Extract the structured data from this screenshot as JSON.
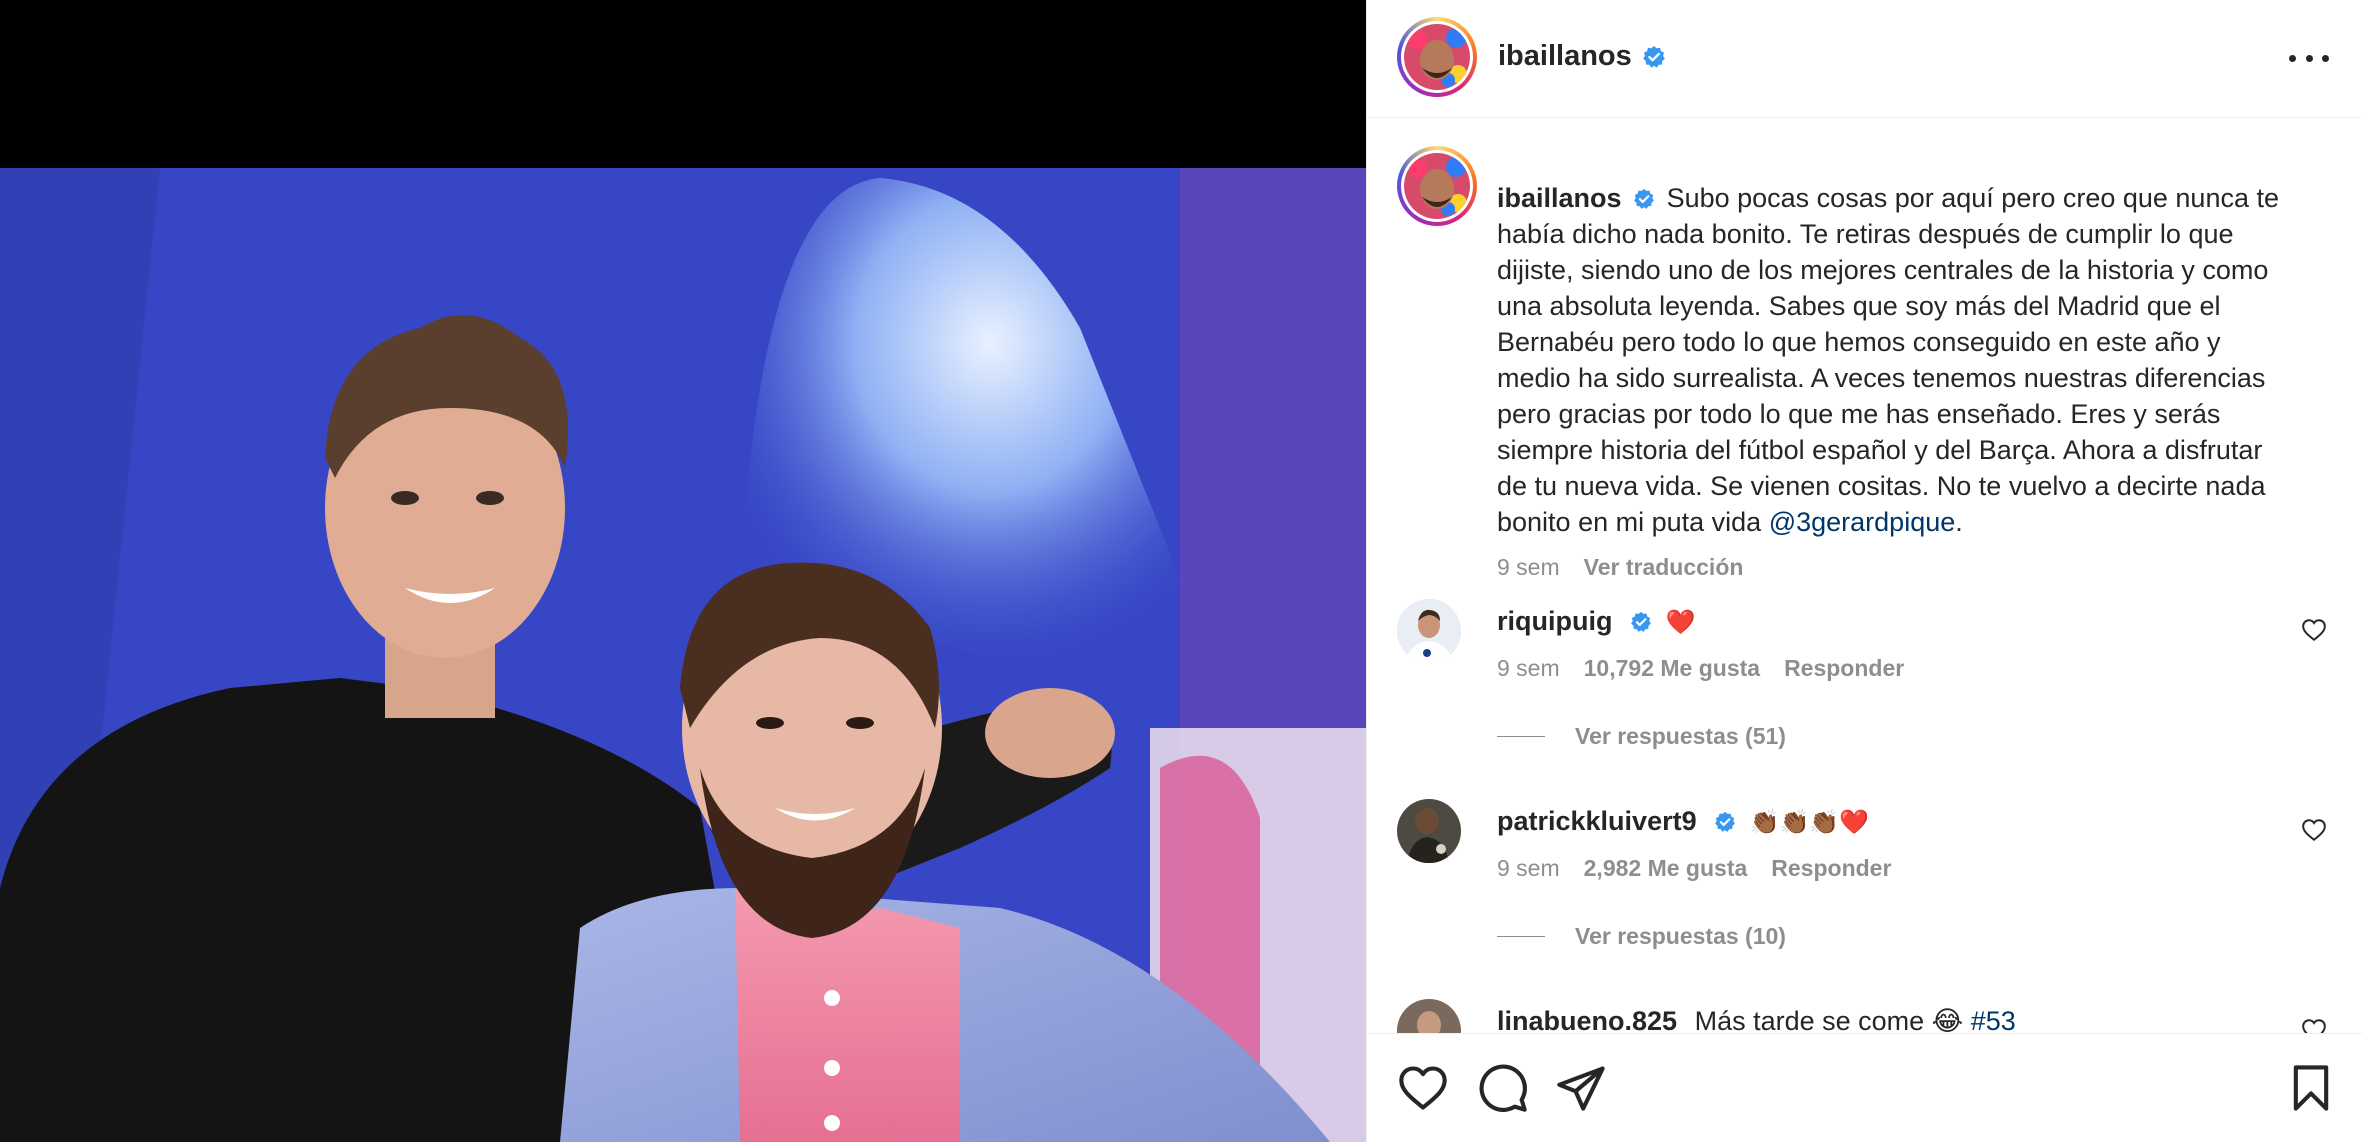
{
  "post": {
    "username": "ibaillanos",
    "more_icon": "more-horizontal-icon",
    "caption_text": "Subo pocas cosas por aquí pero creo que nunca te había dicho nada bonito. Te retiras después de cumplir lo que dijiste, siendo uno de los mejores centrales de la historia y como una absoluta leyenda. Sabes que soy más del Madrid que el Bernabéu pero todo lo que hemos conseguido en este año y medio ha sido surrealista. A veces tenemos nuestras diferencias pero gracias por todo lo que me has enseñado. Eres y serás siempre historia del fútbol español y del Barça. Ahora a disfrutar de tu nueva vida. Se vienen cositas. No te vuelvo a decirte nada bonito en mi puta vida",
    "caption_mention": "@3gerardpique",
    "caption_end": ".",
    "caption_time": "9 sem",
    "translate_label": "Ver traducción"
  },
  "comments": [
    {
      "username": "riquipuig",
      "text": "❤️",
      "time": "9 sem",
      "likes": "10,792 Me gusta",
      "reply_label": "Responder",
      "replies_label": "Ver respuestas (51)"
    },
    {
      "username": "patrickkluivert9",
      "text": "👏🏾👏🏾👏🏾❤️",
      "time": "9 sem",
      "likes": "2,982 Me gusta",
      "reply_label": "Responder",
      "replies_label": "Ver respuestas (10)"
    },
    {
      "username": "linabueno.825",
      "text": "Más tarde se come 😂",
      "hashtag": "#53"
    }
  ],
  "actions": {
    "like_icon": "heart-icon",
    "comment_icon": "comment-icon",
    "share_icon": "send-icon",
    "save_icon": "bookmark-icon"
  },
  "colors": {
    "verified": "#3897f0",
    "link": "#00376b",
    "muted": "#8e8e8e",
    "text": "#262626"
  }
}
